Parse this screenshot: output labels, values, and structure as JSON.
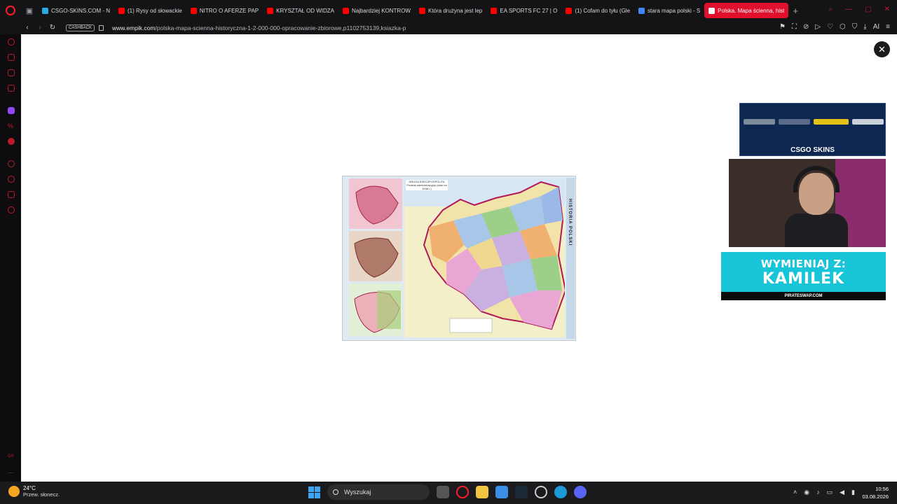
{
  "browser": {
    "tabs": [
      {
        "label": "CSGO-SKINS.COM - N",
        "favicon_color": "#2aa9e0"
      },
      {
        "label": "(1) Rysy od słowackie",
        "favicon_color": "#ff0000"
      },
      {
        "label": "NITRO O AFERZE PAP",
        "favicon_color": "#ff0000"
      },
      {
        "label": "KRYSZTAŁ OD WIDZA",
        "favicon_color": "#ff0000"
      },
      {
        "label": "Najbardziej KONTROW",
        "favicon_color": "#ff0000"
      },
      {
        "label": "Która drużyna jest lep",
        "favicon_color": "#ff0000"
      },
      {
        "label": "EA SPORTS FC 27 | O",
        "favicon_color": "#ff0000"
      },
      {
        "label": "(1) Cofam do tyłu (Gle",
        "favicon_color": "#ff0000"
      },
      {
        "label": "stara mapa polski - S",
        "favicon_color": "#4285f4"
      },
      {
        "label": "Polska. Mapa ścienna, hist",
        "favicon_color": "#ffffff",
        "active": true
      }
    ],
    "new_tab": "+",
    "cashback_label": "CASHBACK",
    "url_host": "www.empik.com",
    "url_path": "/polska-mapa-scienna-historyczna-1-2-000-000-opracowanie-zbiorowe,p1102753139,ksiazka-p",
    "ai_label": "AI"
  },
  "lightbox": {
    "close_symbol": "✕",
    "map_caption": "DRUGA RZECZPOSPOLITA Podział administracyjny (stan na 1938 r.)",
    "map_side_title": "HISTORIA POLSKI"
  },
  "overlays": {
    "ad_brand": "CSGO SKINS",
    "promo_line1": "WYMIENIAJ Z:",
    "promo_line2": "KAMILEK",
    "promo_footer": "PIRATESWAP.COM"
  },
  "taskbar": {
    "temperature": "24°C",
    "weather_desc": "Przew. słonecz.",
    "search_placeholder": "Wyszukaj",
    "time": "10:56",
    "date": "03.08.2026"
  }
}
